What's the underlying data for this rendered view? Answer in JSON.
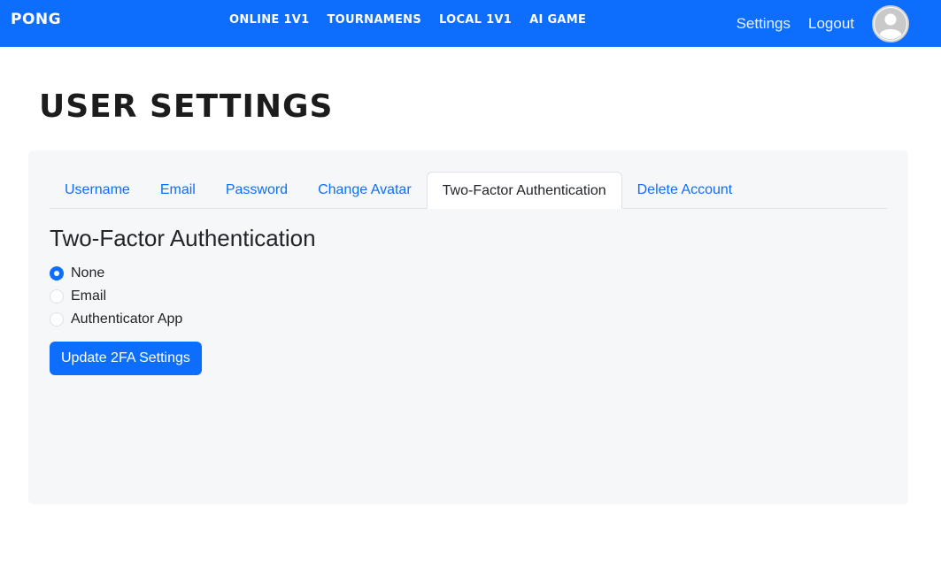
{
  "navbar": {
    "brand": "PONG",
    "links": [
      "ONLINE 1V1",
      "TOURNAMENS",
      "LOCAL 1V1",
      "AI GAME"
    ],
    "right": {
      "settings": "Settings",
      "logout": "Logout"
    },
    "accent": "#0d6efd",
    "avatar_icon": "user-avatar-icon"
  },
  "page": {
    "title": "USER SETTINGS"
  },
  "tabs": [
    {
      "label": "Username"
    },
    {
      "label": "Email"
    },
    {
      "label": "Password"
    },
    {
      "label": "Change Avatar"
    },
    {
      "label": "Two-Factor Authentication",
      "active": true
    },
    {
      "label": "Delete Account"
    }
  ],
  "twofa": {
    "title": "Two-Factor Authentication",
    "options": [
      {
        "label": "None",
        "checked": true
      },
      {
        "label": "Email",
        "checked": false
      },
      {
        "label": "Authenticator App",
        "checked": false
      }
    ],
    "submit_label": "Update 2FA Settings"
  }
}
